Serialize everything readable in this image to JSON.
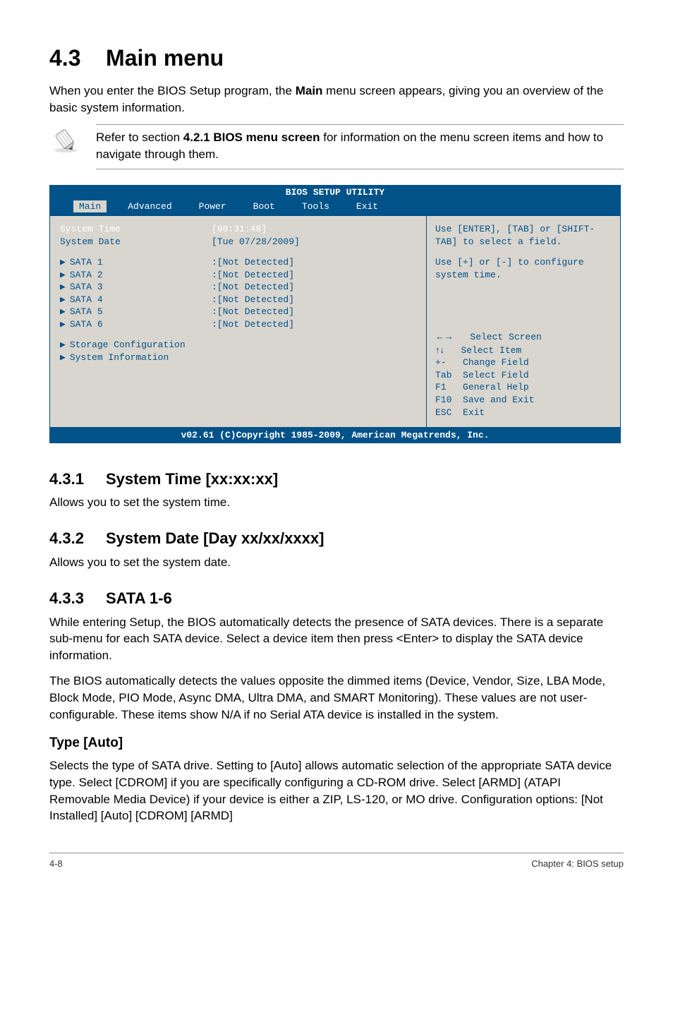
{
  "doc": {
    "section_number": "4.3",
    "section_title": "Main menu",
    "intro_part1": "When you enter the BIOS Setup program, the",
    "intro_bold": "Main",
    "intro_part2": "menu screen appears, giving you an overview of the basic system information.",
    "note_part1": "Refer to section",
    "note_bold": "4.2.1 BIOS menu screen",
    "note_part2": "for information on the menu screen items and how to navigate through them.",
    "s431": {
      "num": "4.3.1",
      "title": "System Time [xx:xx:xx]",
      "text": "Allows you to set the system time."
    },
    "s432": {
      "num": "4.3.2",
      "title": "System Date [Day xx/xx/xxxx]",
      "text": "Allows you to set the system date."
    },
    "s433": {
      "num": "4.3.3",
      "title": "SATA 1-6",
      "p1": "While entering Setup, the BIOS automatically detects the presence of SATA devices. There is a separate sub-menu for each SATA device. Select a device item then press <Enter> to display the SATA device information.",
      "p2": "The BIOS automatically detects the values opposite the dimmed items (Device, Vendor, Size, LBA Mode, Block Mode, PIO Mode, Async DMA, Ultra DMA, and SMART Monitoring). These values are not user-configurable. These items show N/A if no Serial ATA device is installed in the system."
    },
    "type_auto": {
      "heading": "Type [Auto]",
      "text": "Selects the type of SATA drive. Setting to [Auto] allows automatic selection of the appropriate SATA device type. Select [CDROM] if you are specifically configuring a CD-ROM drive. Select [ARMD] (ATAPI Removable Media Device) if your device is either a ZIP, LS-120, or MO drive. Configuration options: [Not Installed] [Auto] [CDROM] [ARMD]"
    },
    "footer": {
      "page": "4-8",
      "chapter": "Chapter 4: BIOS setup"
    }
  },
  "bios": {
    "title": "BIOS SETUP UTILITY",
    "tabs": [
      "Main",
      "Advanced",
      "Power",
      "Boot",
      "Tools",
      "Exit"
    ],
    "left": {
      "time_label": "System Time",
      "time_value": "[00:31:48]",
      "date_label": "System Date",
      "date_value": "[Tue 07/28/2009]",
      "sata": [
        {
          "label": "SATA 1",
          "value": ":[Not Detected]"
        },
        {
          "label": "SATA 2",
          "value": ":[Not Detected]"
        },
        {
          "label": "SATA 3",
          "value": ":[Not Detected]"
        },
        {
          "label": "SATA 4",
          "value": ":[Not Detected]"
        },
        {
          "label": "SATA 5",
          "value": ":[Not Detected]"
        },
        {
          "label": "SATA 6",
          "value": ":[Not Detected]"
        }
      ],
      "storage": "Storage Configuration",
      "sysinfo": "System Information"
    },
    "right": {
      "help1": "Use [ENTER], [TAB] or [SHIFT-TAB] to select a field.",
      "help2": "Use [+] or [-] to configure system time.",
      "legend": [
        "Select Screen",
        "Select Item",
        "Change Field",
        "Select Field",
        "General Help",
        "Save and Exit",
        "Exit"
      ]
    },
    "footer": "v02.61 (C)Copyright 1985-2009, American Megatrends, Inc."
  }
}
